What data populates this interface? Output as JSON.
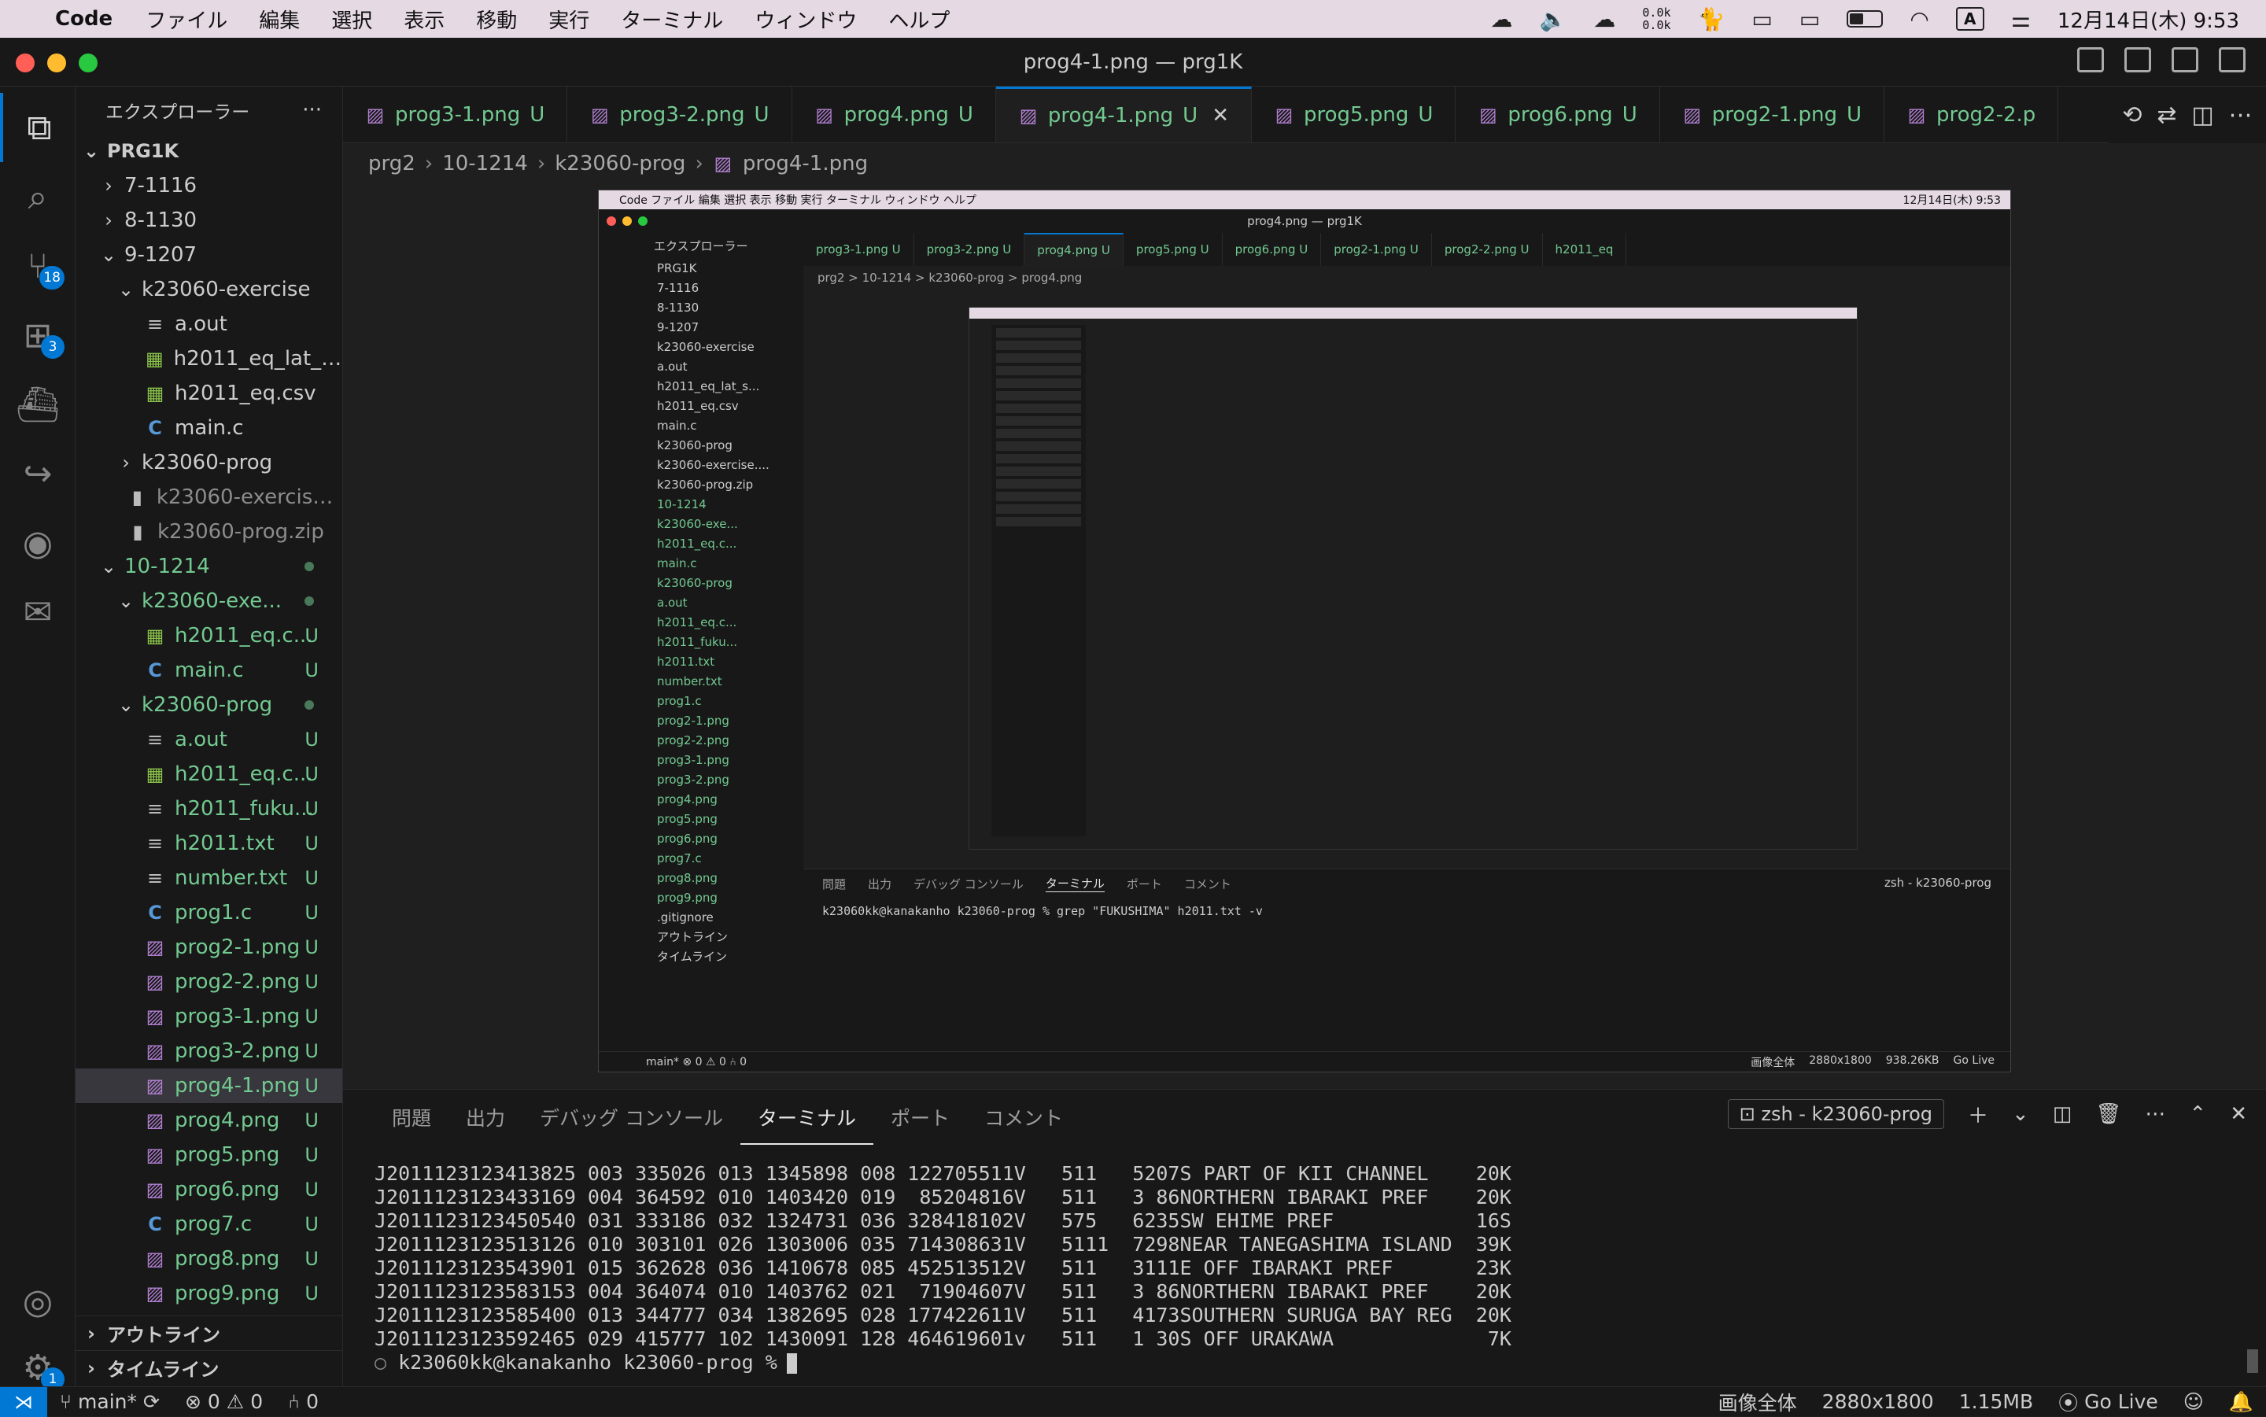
{
  "menubar": {
    "app": "Code",
    "items": [
      "ファイル",
      "編集",
      "選択",
      "表示",
      "移動",
      "実行",
      "ターミナル",
      "ウィンドウ",
      "ヘルプ"
    ],
    "net_up": "0.0k",
    "net_down": "0.0k",
    "input_mode": "A",
    "datetime": "12月14日(木) 9:53"
  },
  "window": {
    "title": "prog4-1.png — prg1K"
  },
  "activity": {
    "scm_badge": "18",
    "ext_badge": "3",
    "settings_badge": "1"
  },
  "sidebar": {
    "title": "エクスプローラー",
    "more": "···",
    "root": "PRG1K",
    "rows": [
      {
        "name": "7-1116",
        "indent": 1,
        "type": "folder",
        "open": false
      },
      {
        "name": "8-1130",
        "indent": 1,
        "type": "folder",
        "open": false
      },
      {
        "name": "9-1207",
        "indent": 1,
        "type": "folder",
        "open": true
      },
      {
        "name": "k23060-exercise",
        "indent": 2,
        "type": "folder",
        "open": true
      },
      {
        "name": "a.out",
        "indent": 3,
        "type": "txt"
      },
      {
        "name": "h2011_eq_lat_s...",
        "indent": 3,
        "type": "csv"
      },
      {
        "name": "h2011_eq.csv",
        "indent": 3,
        "type": "csv"
      },
      {
        "name": "main.c",
        "indent": 3,
        "type": "c"
      },
      {
        "name": "k23060-prog",
        "indent": 2,
        "type": "folder",
        "open": false
      },
      {
        "name": "k23060-exercise....",
        "indent": 2,
        "type": "zip",
        "dim": true
      },
      {
        "name": "k23060-prog.zip",
        "indent": 2,
        "type": "zip",
        "dim": true
      },
      {
        "name": "10-1214",
        "indent": 1,
        "type": "folder",
        "open": true,
        "git": true,
        "dot": true
      },
      {
        "name": "k23060-exe...",
        "indent": 2,
        "type": "folder",
        "open": true,
        "git": true,
        "dot": true
      },
      {
        "name": "h2011_eq.c...",
        "indent": 3,
        "type": "csv",
        "git": true,
        "status": "U"
      },
      {
        "name": "main.c",
        "indent": 3,
        "type": "c",
        "git": true,
        "status": "U"
      },
      {
        "name": "k23060-prog",
        "indent": 2,
        "type": "folder",
        "open": true,
        "git": true,
        "dot": true
      },
      {
        "name": "a.out",
        "indent": 3,
        "type": "txt",
        "git": true,
        "status": "U"
      },
      {
        "name": "h2011_eq.c...",
        "indent": 3,
        "type": "csv",
        "git": true,
        "status": "U"
      },
      {
        "name": "h2011_fuku...",
        "indent": 3,
        "type": "txt",
        "git": true,
        "status": "U"
      },
      {
        "name": "h2011.txt",
        "indent": 3,
        "type": "txt",
        "git": true,
        "status": "U"
      },
      {
        "name": "number.txt",
        "indent": 3,
        "type": "txt",
        "git": true,
        "status": "U"
      },
      {
        "name": "prog1.c",
        "indent": 3,
        "type": "c",
        "git": true,
        "status": "U"
      },
      {
        "name": "prog2-1.png",
        "indent": 3,
        "type": "img",
        "git": true,
        "status": "U"
      },
      {
        "name": "prog2-2.png",
        "indent": 3,
        "type": "img",
        "git": true,
        "status": "U"
      },
      {
        "name": "prog3-1.png",
        "indent": 3,
        "type": "img",
        "git": true,
        "status": "U"
      },
      {
        "name": "prog3-2.png",
        "indent": 3,
        "type": "img",
        "git": true,
        "status": "U"
      },
      {
        "name": "prog4-1.png",
        "indent": 3,
        "type": "img",
        "git": true,
        "status": "U",
        "selected": true
      },
      {
        "name": "prog4.png",
        "indent": 3,
        "type": "img",
        "git": true,
        "status": "U"
      },
      {
        "name": "prog5.png",
        "indent": 3,
        "type": "img",
        "git": true,
        "status": "U"
      },
      {
        "name": "prog6.png",
        "indent": 3,
        "type": "img",
        "git": true,
        "status": "U"
      },
      {
        "name": "prog7.c",
        "indent": 3,
        "type": "c",
        "git": true,
        "status": "U"
      },
      {
        "name": "prog8.png",
        "indent": 3,
        "type": "img",
        "git": true,
        "status": "U"
      },
      {
        "name": "prog9.png",
        "indent": 3,
        "type": "img",
        "git": true,
        "status": "U"
      }
    ],
    "outline": "アウトライン",
    "timeline": "タイムライン"
  },
  "tabs": [
    {
      "label": "prog3-1.png",
      "status": "U"
    },
    {
      "label": "prog3-2.png",
      "status": "U"
    },
    {
      "label": "prog4.png",
      "status": "U"
    },
    {
      "label": "prog4-1.png",
      "status": "U",
      "active": true
    },
    {
      "label": "prog5.png",
      "status": "U"
    },
    {
      "label": "prog6.png",
      "status": "U"
    },
    {
      "label": "prog2-1.png",
      "status": "U"
    },
    {
      "label": "prog2-2.p",
      "status": ""
    }
  ],
  "breadcrumb": [
    "prg2",
    "10-1214",
    "k23060-prog",
    "prog4-1.png"
  ],
  "inner": {
    "menubar": "Code  ファイル  編集  選択  表示  移動  実行  ターミナル  ウィンドウ  ヘルプ",
    "datetime": "12月14日(木) 9:53",
    "title": "prog4.png — prg1K",
    "explorer": "エクスプローラー",
    "tree": [
      "PRG1K",
      "7-1116",
      "8-1130",
      "9-1207",
      "k23060-exercise",
      "a.out",
      "h2011_eq_lat_s...",
      "h2011_eq.csv",
      "main.c",
      "k23060-prog",
      "k23060-exercise....",
      "k23060-prog.zip",
      "10-1214",
      "k23060-exe...",
      "h2011_eq.c...",
      "main.c",
      "k23060-prog",
      "a.out",
      "h2011_eq.c...",
      "h2011_fuku...",
      "h2011.txt",
      "number.txt",
      "prog1.c",
      "prog2-1.png",
      "prog2-2.png",
      "prog3-1.png",
      "prog3-2.png",
      "prog4.png",
      "prog5.png",
      "prog6.png",
      "prog7.c",
      "prog8.png",
      "prog9.png",
      ".gitignore",
      "アウトライン",
      "タイムライン"
    ],
    "tabs": [
      "prog3-1.png U",
      "prog3-2.png U",
      "prog4.png U",
      "prog5.png U",
      "prog6.png U",
      "prog2-1.png U",
      "prog2-2.png U",
      "h2011_eq"
    ],
    "breadcrumb": "prg2 > 10-1214 > k23060-prog > prog4.png",
    "panel_tabs": [
      "問題",
      "出力",
      "デバッグ コンソール",
      "ターミナル",
      "ポート",
      "コメント"
    ],
    "terminal_shell": "zsh - k23060-prog",
    "terminal_line": "k23060kk@kanakanho k23060-prog % grep \"FUKUSHIMA\" h2011.txt -v",
    "status_left": "main*  ⊗ 0 ⚠ 0  ⑃ 0",
    "status_right": [
      "画像全体",
      "2880x1800",
      "938.26KB",
      "Go Live"
    ]
  },
  "panel": {
    "tabs": [
      "問題",
      "出力",
      "デバッグ コンソール",
      "ターミナル",
      "ポート",
      "コメント"
    ],
    "active_tab": 3,
    "shell": "zsh - k23060-prog"
  },
  "terminal": {
    "lines": [
      "J2011123123413825 003 335026 013 1345898 008 122705511V   511   5207S PART OF KII CHANNEL    20K",
      "J2011123123433169 004 364592 010 1403420 019  85204816V   511   3 86NORTHERN IBARAKI PREF    20K",
      "J2011123123450540 031 333186 032 1324731 036 328418102V   575   6235SW EHIME PREF            16S",
      "J2011123123513126 010 303101 026 1303006 035 714308631V   5111  7298NEAR TANEGASHIMA ISLAND  39K",
      "J2011123123543901 015 362628 036 1410678 085 452513512V   511   3111E OFF IBARAKI PREF       23K",
      "J2011123123583153 004 364074 010 1403762 021  71904607V   511   3 86NORTHERN IBARAKI PREF    20K",
      "J2011123123585400 013 344777 034 1382695 028 177422611V   511   4173SOUTHERN SURUGA BAY REG  20K",
      "J2011123123592465 029 415777 102 1430091 128 464619601v   511   1 30S OFF URAKAWA             7K"
    ],
    "prompt": "k23060kk@kanakanho k23060-prog %"
  },
  "statusbar": {
    "branch": "main*",
    "errors": "0",
    "warnings": "0",
    "ports": "0",
    "view": "画像全体",
    "dimensions": "2880x1800",
    "size": "1.15MB",
    "golive": "Go Live"
  }
}
